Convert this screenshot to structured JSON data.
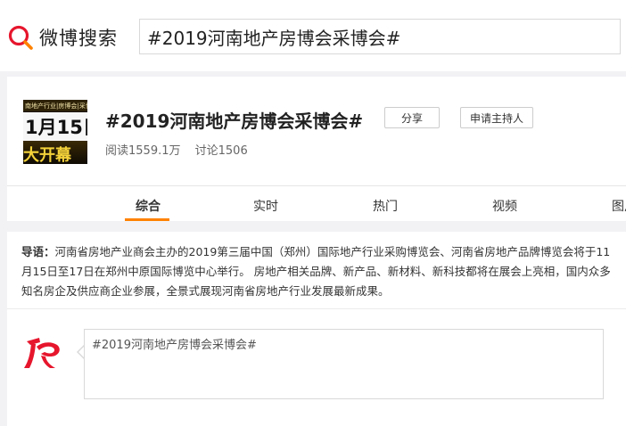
{
  "header": {
    "logo_text": "微博搜索",
    "search_value": "#2019河南地产房博会采博会#"
  },
  "topic": {
    "cover": {
      "top_text": "南地产行业|房博会|采博",
      "mid_text": "1月15日",
      "bottom_text": "大开幕"
    },
    "title": "#2019河南地产房博会采博会#",
    "share_label": "分享",
    "host_label": "申请主持人",
    "reads": "阅读1559.1万",
    "discussions": "讨论1506"
  },
  "tabs": [
    {
      "label": "综合",
      "active": true
    },
    {
      "label": "实时"
    },
    {
      "label": "热门"
    },
    {
      "label": "视频"
    },
    {
      "label": "图片"
    }
  ],
  "intro": {
    "label": "导语：",
    "text": "河南省房地产业商会主办的2019第三届中国（郑州）国际地产行业采购博览会、河南省房地产品牌博览会将于11月15日至17日在郑州中原国际博览中心举行。 房地产相关品牌、新产品、新材料、新科技都将在展会上亮相，国内众多知名房企及供应商企业参展，全景式展现河南省房地产行业发展最新成果。"
  },
  "composer": {
    "value": "#2019河南地产房博会采博会#"
  },
  "colors": {
    "accent": "#ff8200",
    "logo_red": "#e6162d",
    "background": "#f2f2f5"
  }
}
